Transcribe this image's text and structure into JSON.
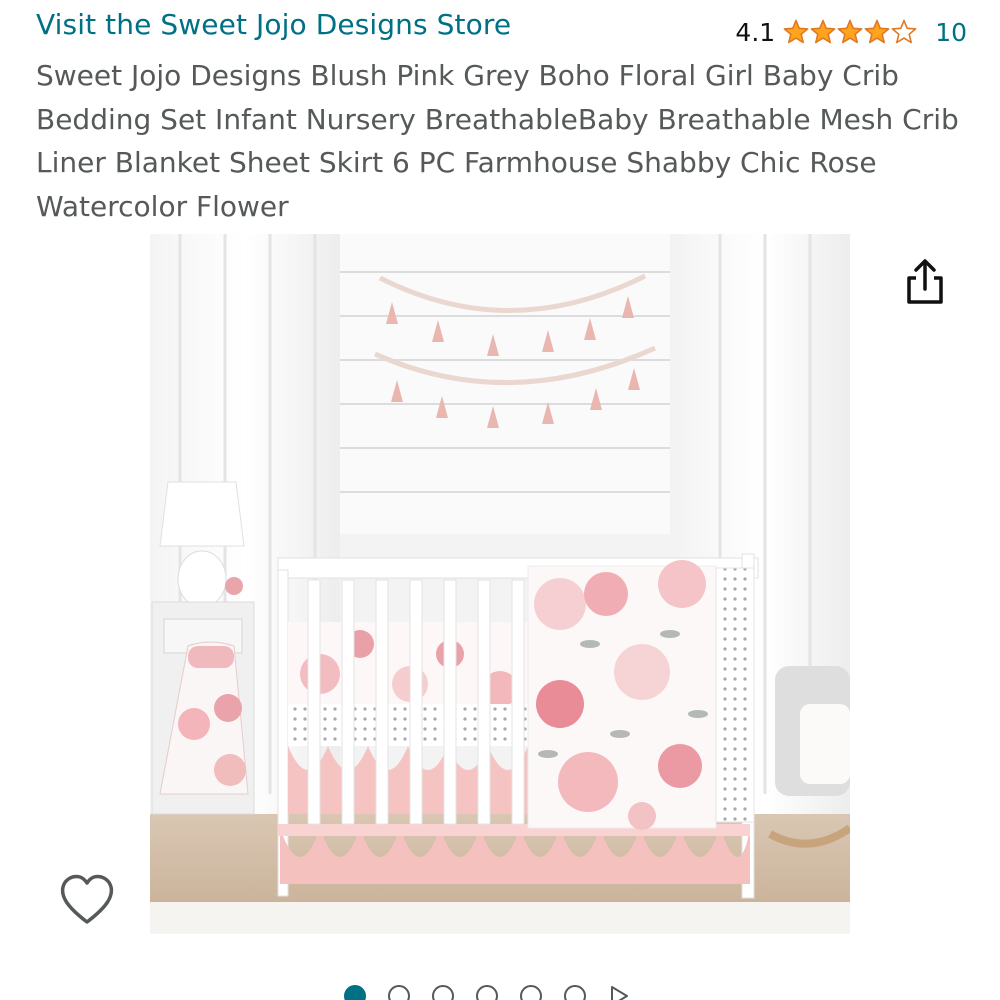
{
  "store": {
    "link_text": "Visit the Sweet Jojo Designs Store"
  },
  "rating": {
    "value": "4.1",
    "stars": 4.1,
    "max_stars": 5,
    "count": "10",
    "star_color": "#ffa41c"
  },
  "product": {
    "title": "Sweet Jojo Designs Blush Pink Grey Boho Floral Girl Baby Crib Bedding Set Infant Nursery BreathableBaby Breathable Mesh Crib Liner Blanket Sheet Skirt 6 PC Farmhouse Shabby Chic Rose Watercolor Flower"
  },
  "image": {
    "subject": "white crib with blush pink floral bedding in nursery"
  },
  "actions": {
    "share_icon": "share-icon",
    "wishlist_icon": "heart-icon"
  },
  "carousel": {
    "total_dots": 6,
    "active_index": 0,
    "has_next_arrow": true
  },
  "colors": {
    "link": "#007185",
    "title": "#565959",
    "blush": "#f4c6c6",
    "rose": "#e89aa2"
  }
}
